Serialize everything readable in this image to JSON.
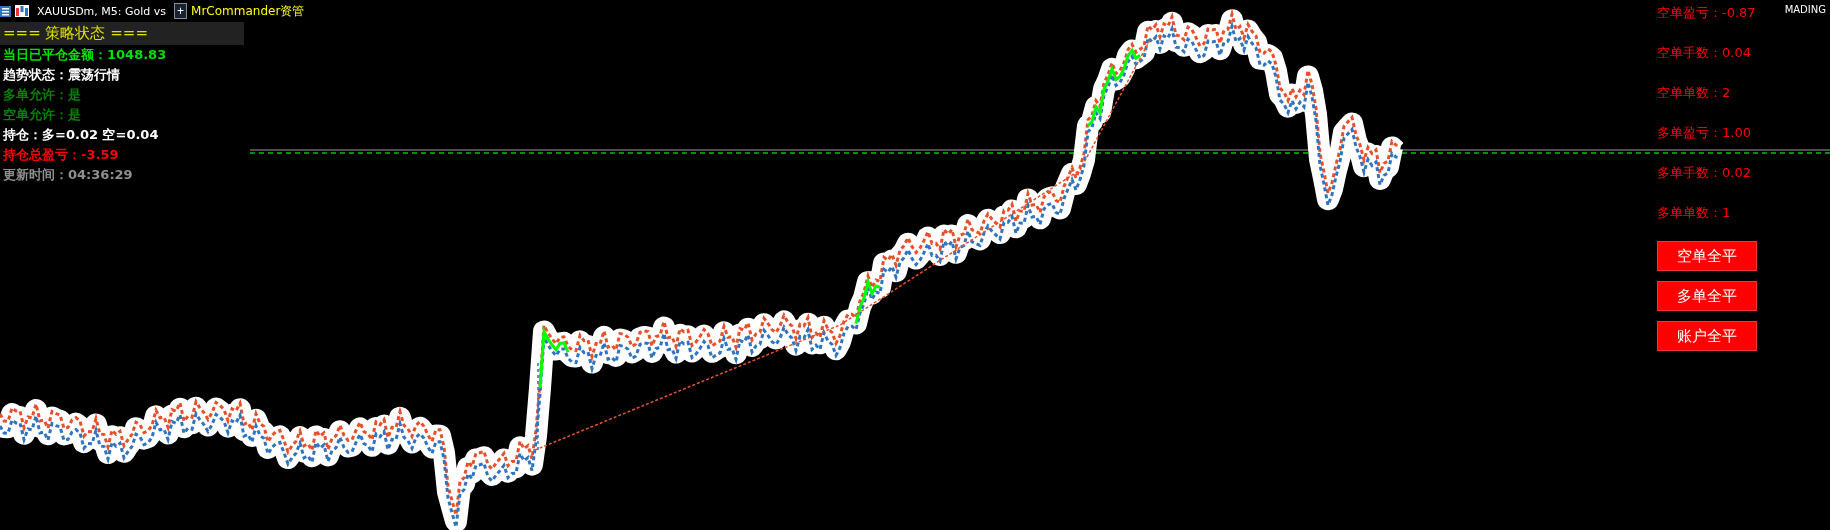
{
  "title_bar": {
    "title": "XAUUSDm, M5: Gold vs",
    "add_button": "+",
    "ea_name": "MrCommander资管",
    "account_label": "MADING"
  },
  "status_panel": {
    "heading": "=== 策略状态 ===",
    "lines": [
      {
        "text": "当日已平仓金额：1048.83",
        "color": "#00e000"
      },
      {
        "text": "趋势状态：震荡行情",
        "color": "#ffffff"
      },
      {
        "text": "多单允许：是",
        "color": "#008000"
      },
      {
        "text": "空单允许：是",
        "color": "#008000"
      },
      {
        "text": "持仓：多=0.02 空=0.04",
        "color": "#ffffff"
      },
      {
        "text": "持仓总盈亏：-3.59",
        "color": "#ff0000"
      },
      {
        "text": "更新时间：04:36:29",
        "color": "#909090"
      }
    ]
  },
  "position_panel": {
    "lines": [
      {
        "text": "空单盈亏：-0.87"
      },
      {
        "text": "空单手数：0.04"
      },
      {
        "text": "空单单数：2"
      },
      {
        "text": "多单盈亏：1.00"
      },
      {
        "text": "多单手数：0.02"
      },
      {
        "text": "多单单数：1"
      }
    ]
  },
  "buttons": [
    "空单全平",
    "多单全平",
    "账户全平"
  ]
}
